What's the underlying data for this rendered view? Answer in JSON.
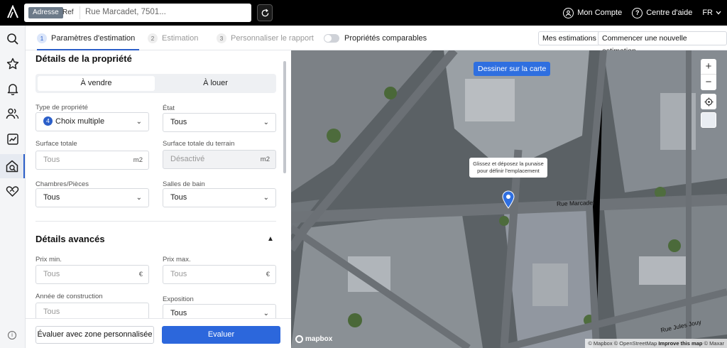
{
  "topbar": {
    "search_mode_active": "Adresse",
    "search_mode_inactive": "Ref",
    "search_value": "Rue Marcadet, 7501...",
    "account_label": "Mon Compte",
    "help_label": "Centre d'aide",
    "language": "FR"
  },
  "sidebar": {
    "items": [
      {
        "icon": "search-icon"
      },
      {
        "icon": "star-icon"
      },
      {
        "icon": "bell-icon"
      },
      {
        "icon": "users-icon"
      },
      {
        "icon": "chart-icon"
      },
      {
        "icon": "house-estimate-icon",
        "active": true
      },
      {
        "icon": "handshake-icon"
      }
    ],
    "info_label": "i"
  },
  "steps": [
    {
      "num": "1",
      "label": "Paramètres d'estimation",
      "active": true
    },
    {
      "num": "2",
      "label": "Estimation",
      "active": false
    },
    {
      "num": "3",
      "label": "Personnaliser le rapport",
      "active": false
    }
  ],
  "toggle": {
    "label": "Propriétés comparables",
    "on": false
  },
  "header_buttons": {
    "my_estimations": "Mes estimations",
    "new_estimation": "Commencer une nouvelle estimation"
  },
  "form": {
    "property_section_title": "Détails de la propriété",
    "mode": {
      "sale": "À vendre",
      "rent": "À louer",
      "selected": "sale"
    },
    "property_type": {
      "label": "Type de propriété",
      "count": "4",
      "value": "Choix multiple"
    },
    "state": {
      "label": "État",
      "value": "Tous"
    },
    "total_area": {
      "label": "Surface totale",
      "placeholder": "Tous",
      "unit": "m2"
    },
    "land_area": {
      "label": "Surface totale du terrain",
      "placeholder": "Désactivé",
      "unit": "m2"
    },
    "bedrooms": {
      "label": "Chambres/Pièces",
      "value": "Tous"
    },
    "bathrooms": {
      "label": "Salles de bain",
      "value": "Tous"
    },
    "advanced_section_title": "Détails avancés",
    "min_price": {
      "label": "Prix min.",
      "placeholder": "Tous",
      "unit": "€"
    },
    "max_price": {
      "label": "Prix max.",
      "placeholder": "Tous",
      "unit": "€"
    },
    "construction_year": {
      "label": "Année de construction",
      "placeholder": "Tous"
    },
    "exposure": {
      "label": "Exposition",
      "value": "Tous"
    }
  },
  "actions": {
    "custom_zone": "Évaluer avec zone personnalisée",
    "evaluate": "Evaluer"
  },
  "map": {
    "draw_button": "Dessiner sur la carte",
    "zoom_in": "+",
    "zoom_out": "−",
    "tooltip": "Glissez et déposez la punaise pour définir l'emplacement",
    "streets": [
      "Rue Marcadet",
      "Rue Jules Jouy"
    ],
    "logo": "mapbox",
    "attribution_osm": "© Mapbox © OpenStreetMap",
    "attribution_improve": "Improve this map",
    "attribution_maxar": "© Maxar"
  },
  "colors": {
    "accent": "#2c67dc",
    "topbar": "#000000",
    "map_button": "#2f6fe0"
  }
}
